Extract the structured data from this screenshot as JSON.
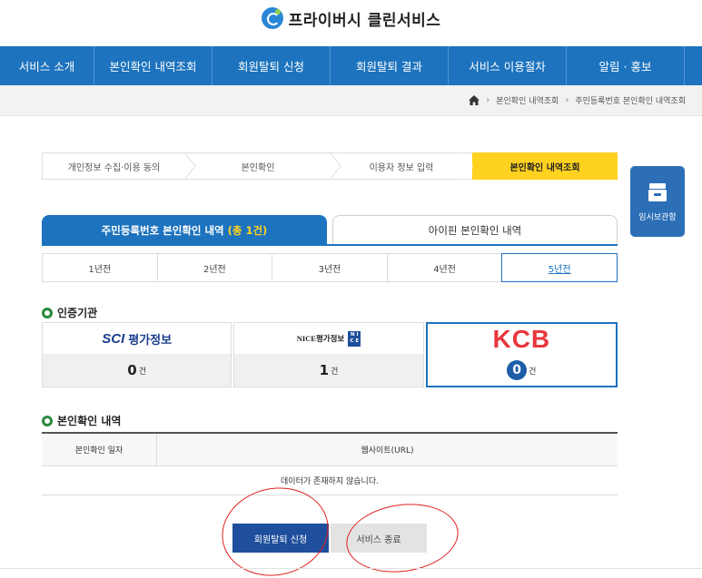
{
  "header": {
    "title": "프라이버시 클린서비스",
    "logo_icon": "e-logo-icon"
  },
  "nav": {
    "items": [
      {
        "label": "서비스 소개"
      },
      {
        "label": "본인확인 내역조회"
      },
      {
        "label": "회원탈퇴 신청"
      },
      {
        "label": "회원탈퇴 결과"
      },
      {
        "label": "서비스 이용절차"
      },
      {
        "label": "알림 · 홍보"
      }
    ]
  },
  "breadcrumb": {
    "home_icon": "home-icon",
    "items": [
      "본인확인 내역조회",
      "주민등록번호 본인확인 내역조회"
    ]
  },
  "steps": [
    {
      "label": "개인정보 수집·이용 동의",
      "active": false
    },
    {
      "label": "본인확인",
      "active": false
    },
    {
      "label": "이용자 정보 입력",
      "active": false
    },
    {
      "label": "본인확인 내역조회",
      "active": true
    }
  ],
  "side_tool": {
    "label": "임시보관함",
    "icon": "archive-box-icon"
  },
  "tabs": {
    "active": {
      "label": "주민등록번호 본인확인 내역",
      "count": "(총 1건)"
    },
    "inactive": {
      "label": "아이핀 본인확인 내역"
    }
  },
  "years": {
    "items": [
      "1년전",
      "2년전",
      "3년전",
      "4년전",
      "5년전"
    ],
    "selected": "5년전"
  },
  "agencies_section": {
    "title": "인증기관"
  },
  "agencies": [
    {
      "name": "SCI",
      "subtitle": "평가정보",
      "count": "0",
      "unit": "건",
      "selected": false
    },
    {
      "name": "NICE평가정보",
      "box_text_top": "N I",
      "box_text_bottom": "C E",
      "count": "1",
      "unit": "건",
      "selected": false
    },
    {
      "name": "KCB",
      "count": "0",
      "unit": "건",
      "selected": true
    }
  ],
  "history_section": {
    "title": "본인확인 내역"
  },
  "table": {
    "columns": [
      "본인확인 일자",
      "웹사이트(URL)"
    ],
    "empty_message": "데이터가 존재하지 않습니다."
  },
  "actions": {
    "primary": "회원탈퇴 신청",
    "secondary": "서비스 종료"
  },
  "colors": {
    "nav_bg": "#1d73be",
    "step_active": "#ffd21f",
    "annotation": "#e01f1f",
    "kcb_red": "#e8373d"
  }
}
